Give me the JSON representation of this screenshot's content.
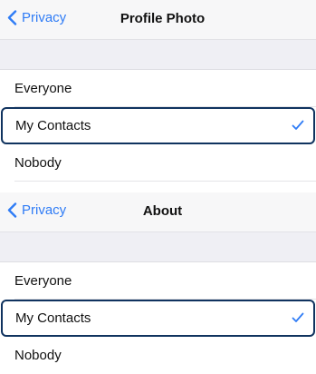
{
  "screens": [
    {
      "back_label": "Privacy",
      "title": "Profile Photo",
      "options": [
        "Everyone",
        "My Contacts",
        "Nobody"
      ],
      "selected_index": 1
    },
    {
      "back_label": "Privacy",
      "title": "About",
      "options": [
        "Everyone",
        "My Contacts",
        "Nobody"
      ],
      "selected_index": 1
    }
  ],
  "colors": {
    "accent": "#2f7cf6",
    "highlight_border": "#10335f",
    "group_bg": "#efeff4"
  },
  "icons": {
    "back": "chevron-left-icon",
    "selected": "checkmark-icon"
  }
}
